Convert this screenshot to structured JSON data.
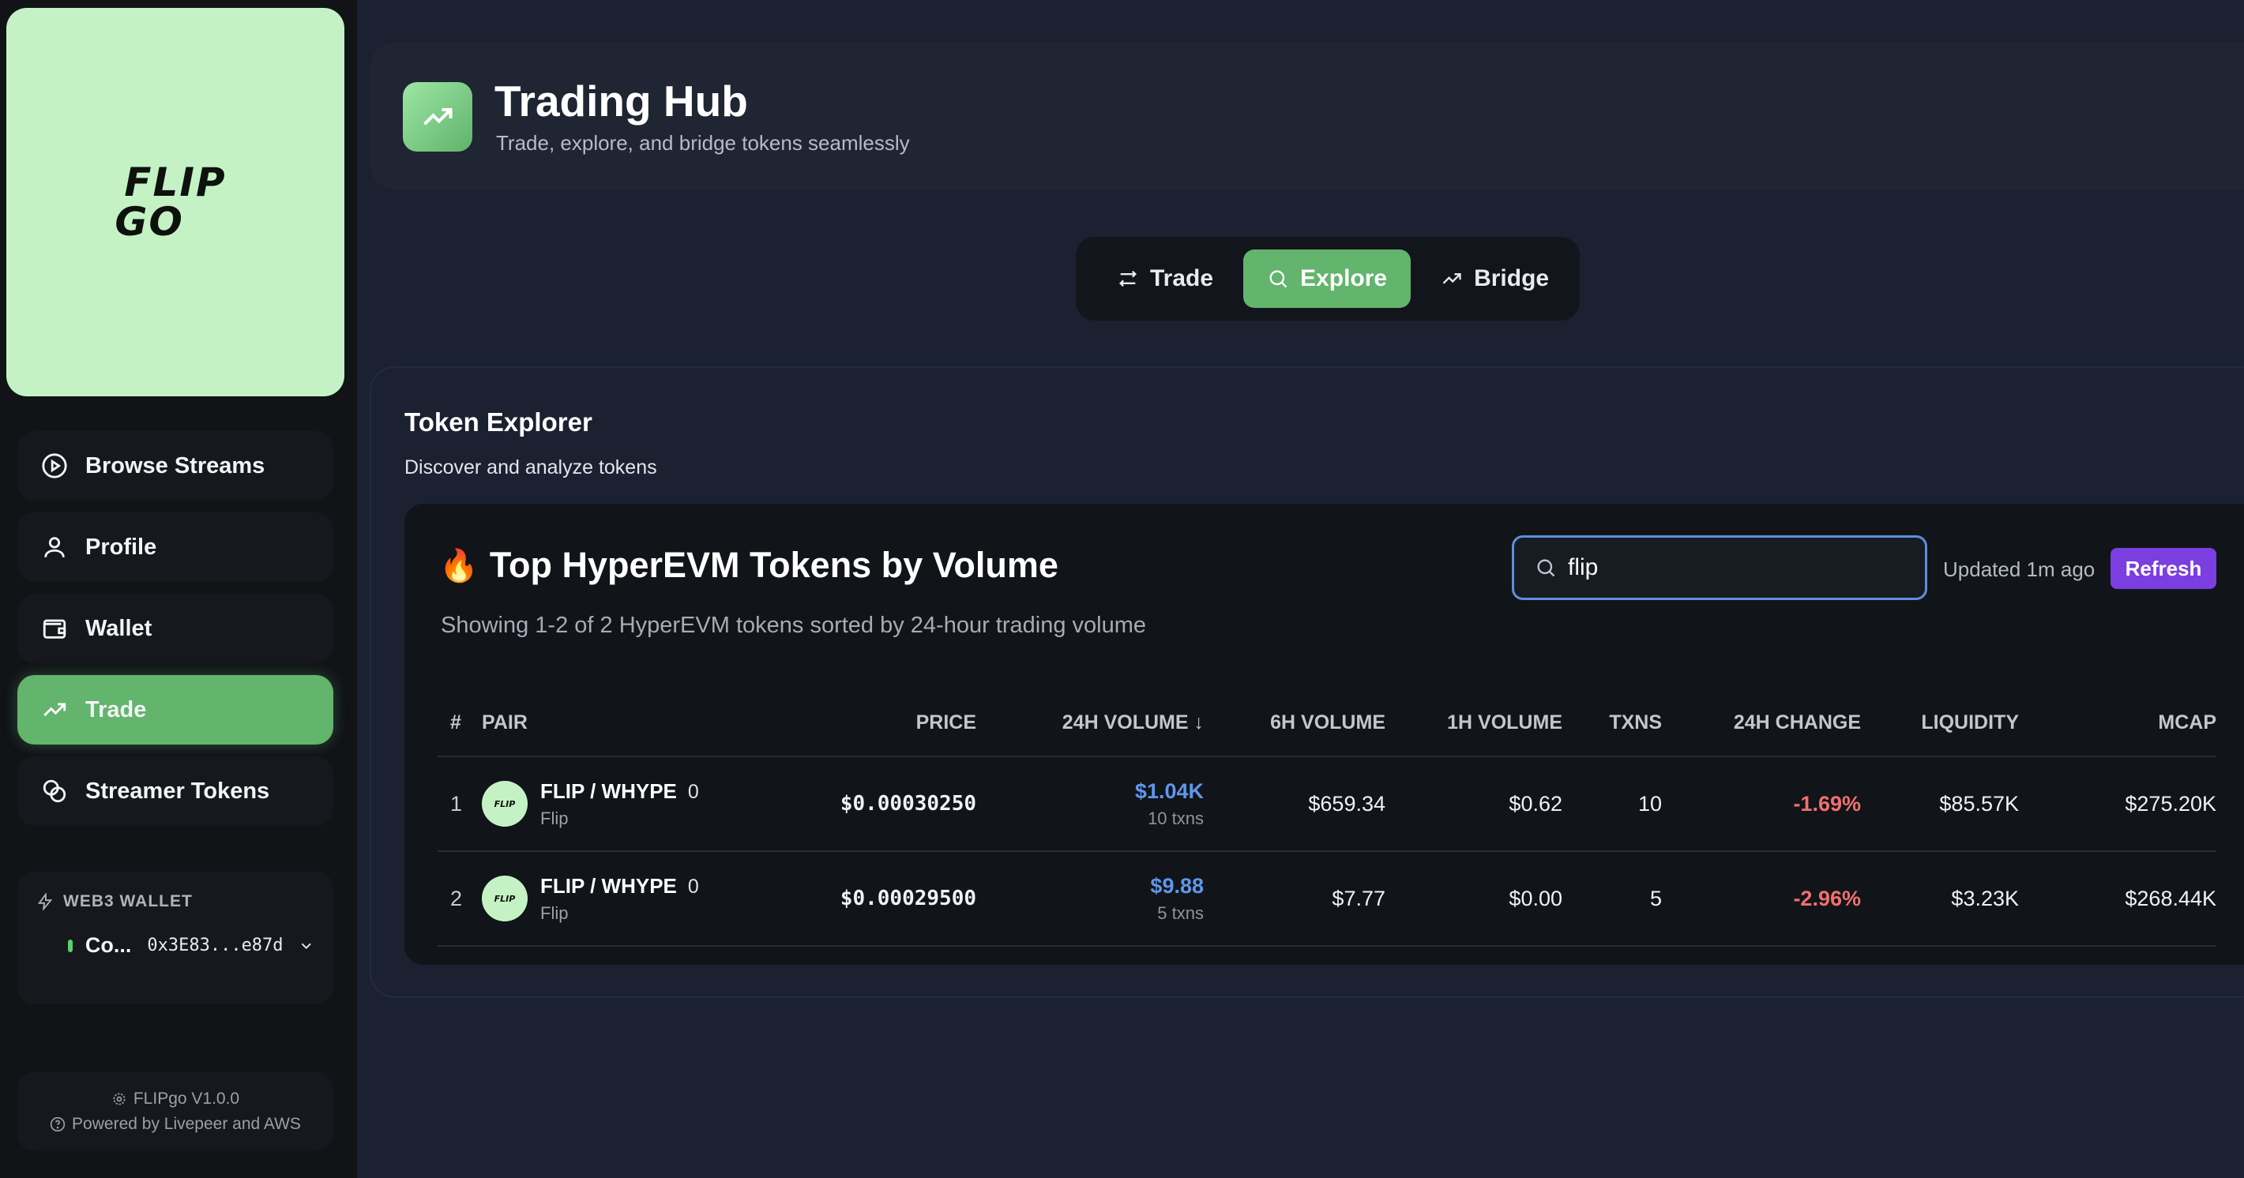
{
  "sidebar": {
    "logo_line1": "FLIP",
    "logo_line2": "GO",
    "nav": [
      {
        "label": "Browse Streams",
        "icon": "play-circle-icon"
      },
      {
        "label": "Profile",
        "icon": "user-icon"
      },
      {
        "label": "Wallet",
        "icon": "wallet-icon"
      },
      {
        "label": "Trade",
        "icon": "trending-up-icon",
        "active": true
      },
      {
        "label": "Streamer Tokens",
        "icon": "coins-icon"
      }
    ],
    "wallet": {
      "heading": "WEB3 WALLET",
      "status": "Co...",
      "address": "0x3E83...e87d"
    },
    "footer": {
      "version": "FLIPgo V1.0.0",
      "powered": "Powered by Livepeer and AWS"
    }
  },
  "header": {
    "title": "Trading Hub",
    "subtitle": "Trade, explore, and bridge tokens seamlessly"
  },
  "tabs": [
    {
      "label": "Trade",
      "icon": "swap-arrows-icon"
    },
    {
      "label": "Explore",
      "icon": "search-icon",
      "active": true
    },
    {
      "label": "Bridge",
      "icon": "trending-up-icon"
    }
  ],
  "explorer": {
    "title": "Token Explorer",
    "subtitle": "Discover and analyze tokens",
    "tokens_title": "Top HyperEVM Tokens by Volume",
    "tokens_subtitle": "Showing 1-2 of 2 HyperEVM tokens sorted by 24-hour trading volume",
    "search_value": "flip",
    "updated": "Updated 1m ago",
    "refresh_label": "Refresh"
  },
  "table": {
    "columns": [
      "#",
      "PAIR",
      "PRICE",
      "24H VOLUME ↓",
      "6H VOLUME",
      "1H VOLUME",
      "TXNS",
      "24H CHANGE",
      "LIQUIDITY",
      "MCAP"
    ],
    "rows": [
      {
        "idx": "1",
        "pair": "FLIP / WHYPE",
        "badge": "0",
        "name": "Flip",
        "price": "$0.00030250",
        "vol24": "$1.04K",
        "txns_sub": "10 txns",
        "vol6": "$659.34",
        "vol1": "$0.62",
        "txns": "10",
        "change": "-1.69%",
        "liquidity": "$85.57K",
        "mcap": "$275.20K"
      },
      {
        "idx": "2",
        "pair": "FLIP / WHYPE",
        "badge": "0",
        "name": "Flip",
        "price": "$0.00029500",
        "vol24": "$9.88",
        "txns_sub": "5 txns",
        "vol6": "$7.77",
        "vol1": "$0.00",
        "txns": "5",
        "change": "-2.96%",
        "liquidity": "$3.23K",
        "mcap": "$268.44K"
      }
    ]
  },
  "colors": {
    "accent_green": "#63b46d",
    "logo_bg": "#c4f2c5",
    "refresh_purple": "#7b3ee0",
    "volume_blue": "#5f97ea",
    "negative_red": "#f07070"
  }
}
